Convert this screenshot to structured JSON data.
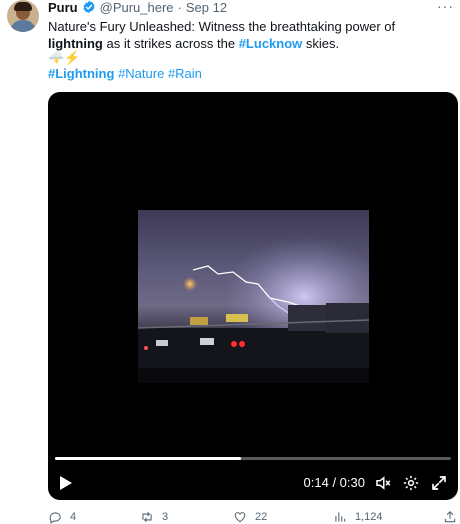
{
  "author": {
    "name": "Puru",
    "handle": "@Puru_here",
    "separator": "·",
    "date": "Sep 12"
  },
  "tweet": {
    "text_part1": "Nature's Fury Unleashed: Witness the breathtaking power of ",
    "bold_word": "lightning",
    "text_part2": " as it strikes across the ",
    "lucknow_tag": "#Lucknow",
    "text_part3": " skies.",
    "emojis": "🌩️⚡",
    "hashtags": [
      "#Lightning",
      "#Nature",
      "#Rain"
    ]
  },
  "video": {
    "current_time": "0:14",
    "duration": "0:30",
    "time_display": "0:14 / 0:30",
    "progress_fraction": 0.47
  },
  "actions": {
    "replies": "4",
    "retweets": "3",
    "likes": "22",
    "views": "1,124"
  },
  "colors": {
    "link": "#1d9bf0",
    "secondary_text": "#536471",
    "verified": "#1d9bf0"
  },
  "icons": [
    "more-icon",
    "verified-icon",
    "play-icon",
    "volume-icon",
    "settings-icon",
    "fullscreen-icon",
    "reply-icon",
    "retweet-icon",
    "like-icon",
    "views-icon",
    "share-icon"
  ]
}
